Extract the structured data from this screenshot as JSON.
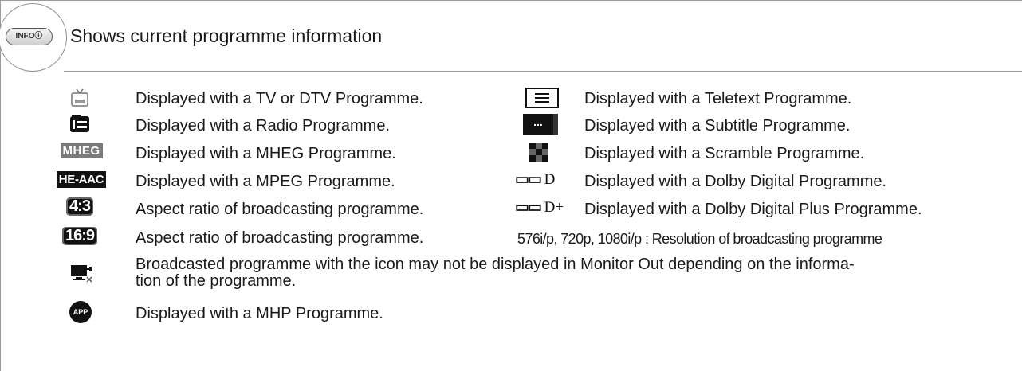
{
  "header": {
    "button_label": "INFOⓘ",
    "title": "Shows current programme information"
  },
  "left_items": [
    {
      "icon": "tv-icon",
      "text": "Displayed with a TV or DTV Programme."
    },
    {
      "icon": "radio-icon",
      "text": "Displayed with a Radio Programme."
    },
    {
      "icon": "mheg-icon",
      "badge": "MHEG",
      "text": "Displayed with a MHEG Programme."
    },
    {
      "icon": "he-aac-icon",
      "badge": "HE-AAC",
      "text": "Displayed with a MPEG Programme."
    },
    {
      "icon": "aspect-4-3-icon",
      "badge": "4:3",
      "text": "Aspect ratio of broadcasting programme."
    },
    {
      "icon": "aspect-16-9-icon",
      "badge": "16:9",
      "text": "Aspect ratio of broadcasting programme."
    }
  ],
  "right_items": [
    {
      "icon": "teletext-icon",
      "text": "Displayed with a Teletext Programme."
    },
    {
      "icon": "subtitle-icon",
      "badge": "...",
      "text": "Displayed with a Subtitle Programme."
    },
    {
      "icon": "scramble-icon",
      "text": "Displayed with a Scramble Programme."
    },
    {
      "icon": "dolby-digital-icon",
      "badge": "D",
      "text": "Displayed with a Dolby Digital Programme."
    },
    {
      "icon": "dolby-digital-plus-icon",
      "badge": "D+",
      "text": "Displayed with a Dolby Digital Plus Programme."
    }
  ],
  "resolution_note": "576i/p, 720p, 1080i/p : Resolution of broadcasting programme",
  "monitor_out_note": "Broadcasted programme with the icon may not be displayed in Monitor Out depending on the informa-tion of the programme.",
  "monitor_out_line1": "Broadcasted programme with the icon may not be displayed in Monitor Out depending on the informa-",
  "monitor_out_line2": "tion of the programme.",
  "mhp_item": {
    "icon": "app-icon",
    "badge": "APP",
    "text": "Displayed with a MHP Programme."
  }
}
